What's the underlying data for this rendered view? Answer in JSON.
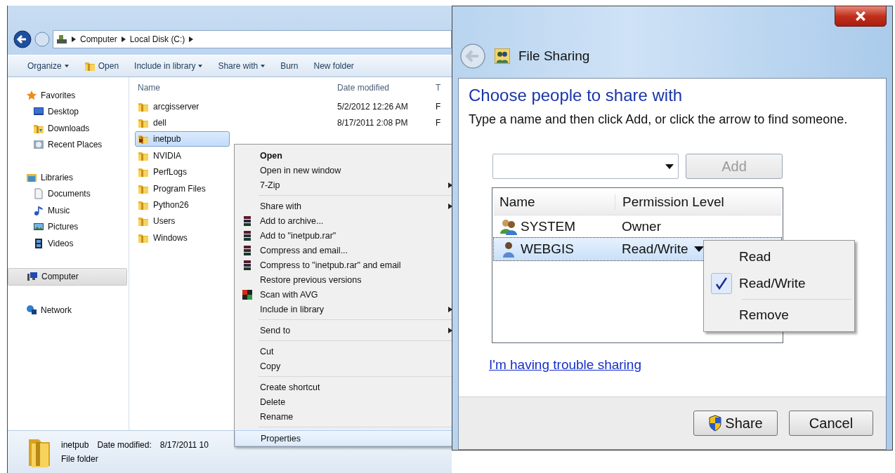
{
  "explorer": {
    "breadcrumbs": [
      "Computer",
      "Local Disk (C:)"
    ],
    "toolbar": [
      {
        "label": "Organize",
        "dropdown": true,
        "kind": "text"
      },
      {
        "label": "Open",
        "dropdown": false,
        "kind": "folder"
      },
      {
        "label": "Include in library",
        "dropdown": true,
        "kind": "text"
      },
      {
        "label": "Share with",
        "dropdown": true,
        "kind": "text"
      },
      {
        "label": "Burn",
        "dropdown": false,
        "kind": "text"
      },
      {
        "label": "New folder",
        "dropdown": false,
        "kind": "text"
      }
    ],
    "sidebar": [
      {
        "label": "Favorites",
        "kind": "star",
        "selected": false,
        "children": [
          {
            "label": "Desktop",
            "kind": "desktop",
            "selected": false
          },
          {
            "label": "Downloads",
            "kind": "downloads",
            "selected": false
          },
          {
            "label": "Recent Places",
            "kind": "recent",
            "selected": false
          }
        ]
      },
      {
        "label": "Libraries",
        "kind": "libraries",
        "selected": false,
        "children": [
          {
            "label": "Documents",
            "kind": "document",
            "selected": false
          },
          {
            "label": "Music",
            "kind": "music",
            "selected": false
          },
          {
            "label": "Pictures",
            "kind": "pictures",
            "selected": false
          },
          {
            "label": "Videos",
            "kind": "videos",
            "selected": false
          }
        ]
      },
      {
        "label": "Computer",
        "kind": "computer",
        "selected": true
      },
      {
        "label": "Network",
        "kind": "network",
        "selected": false
      }
    ],
    "columns": [
      "Name",
      "Date modified",
      "T"
    ],
    "rows": [
      {
        "name": "arcgisserver",
        "date": "5/2/2012 12:26 AM",
        "column_3": "F",
        "selected": false,
        "locked": false
      },
      {
        "name": "dell",
        "date": "8/17/2011 2:08 PM",
        "column_3": "F",
        "selected": false,
        "locked": false
      },
      {
        "name": "inetpub",
        "selected": true,
        "locked": true
      },
      {
        "name": "NVIDIA",
        "selected": false,
        "locked": false
      },
      {
        "name": "PerfLogs",
        "selected": false,
        "locked": false
      },
      {
        "name": "Program Files",
        "selected": false,
        "locked": false
      },
      {
        "name": "Python26",
        "selected": false,
        "locked": false
      },
      {
        "name": "Users",
        "selected": false,
        "locked": false
      },
      {
        "name": "Windows",
        "selected": false,
        "locked": false
      }
    ],
    "details": {
      "name": "inetpub",
      "date_label": "Date modified:",
      "date": "8/17/2011 10",
      "type": "File folder"
    },
    "context_menu": [
      {
        "kind": "item",
        "label": "Open",
        "default": true,
        "selected": false,
        "submenu": false
      },
      {
        "kind": "item",
        "label": "Open in new window",
        "default": false,
        "selected": false,
        "submenu": false
      },
      {
        "kind": "item",
        "label": "7-Zip",
        "default": false,
        "selected": false,
        "submenu": true
      },
      {
        "kind": "separator"
      },
      {
        "kind": "item",
        "label": "Share with",
        "default": false,
        "selected": false,
        "submenu": true
      },
      {
        "kind": "archive",
        "label": "Add to archive...",
        "default": false,
        "selected": false,
        "submenu": false
      },
      {
        "kind": "archive",
        "label": "Add to \"inetpub.rar\"",
        "default": false,
        "selected": false,
        "submenu": false
      },
      {
        "kind": "archive",
        "label": "Compress and email...",
        "default": false,
        "selected": false,
        "submenu": false
      },
      {
        "kind": "archive",
        "label": "Compress to \"inetpub.rar\" and email",
        "default": false,
        "selected": false,
        "submenu": false
      },
      {
        "kind": "item",
        "label": "Restore previous versions",
        "default": false,
        "selected": false,
        "submenu": false
      },
      {
        "kind": "scan",
        "label": "Scan with AVG",
        "default": false,
        "selected": false,
        "submenu": false
      },
      {
        "kind": "item",
        "label": "Include in library",
        "default": false,
        "selected": false,
        "submenu": true
      },
      {
        "kind": "separator"
      },
      {
        "kind": "item",
        "label": "Send to",
        "default": false,
        "selected": false,
        "submenu": true
      },
      {
        "kind": "separator"
      },
      {
        "kind": "item",
        "label": "Cut",
        "default": false,
        "selected": false,
        "submenu": false
      },
      {
        "kind": "item",
        "label": "Copy",
        "default": false,
        "selected": false,
        "submenu": false
      },
      {
        "kind": "separator"
      },
      {
        "kind": "item",
        "label": "Create shortcut",
        "default": false,
        "selected": false,
        "submenu": false
      },
      {
        "kind": "item",
        "label": "Delete",
        "default": false,
        "selected": false,
        "submenu": false
      },
      {
        "kind": "item",
        "label": "Rename",
        "default": false,
        "selected": false,
        "submenu": false
      },
      {
        "kind": "separator"
      },
      {
        "kind": "item",
        "label": "Properties",
        "default": false,
        "selected": true,
        "submenu": false
      }
    ]
  },
  "dialog": {
    "title": "File Sharing",
    "heading": "Choose people to share with",
    "instruction": "Type a name and then click Add, or click the arrow to find someone.",
    "add_button": {
      "label": "Add",
      "disabled": true
    },
    "columns": [
      "Name",
      "Permission Level"
    ],
    "rows": [
      {
        "name": "SYSTEM",
        "permission": "Owner",
        "kind": "group",
        "selected": false,
        "dropdown": false
      },
      {
        "name": "WEBGIS",
        "permission": "Read/Write",
        "kind": "user",
        "selected": true,
        "dropdown": true
      }
    ],
    "permission_menu": [
      {
        "kind": "item",
        "label": "Read",
        "checked": false
      },
      {
        "kind": "item",
        "label": "Read/Write",
        "checked": true
      },
      {
        "kind": "separator"
      },
      {
        "kind": "item",
        "label": "Remove",
        "checked": false
      }
    ],
    "link": "I'm having trouble sharing",
    "buttons": [
      {
        "label": "Share",
        "kind": "shield"
      },
      {
        "label": "Cancel",
        "kind": "plain"
      }
    ]
  }
}
